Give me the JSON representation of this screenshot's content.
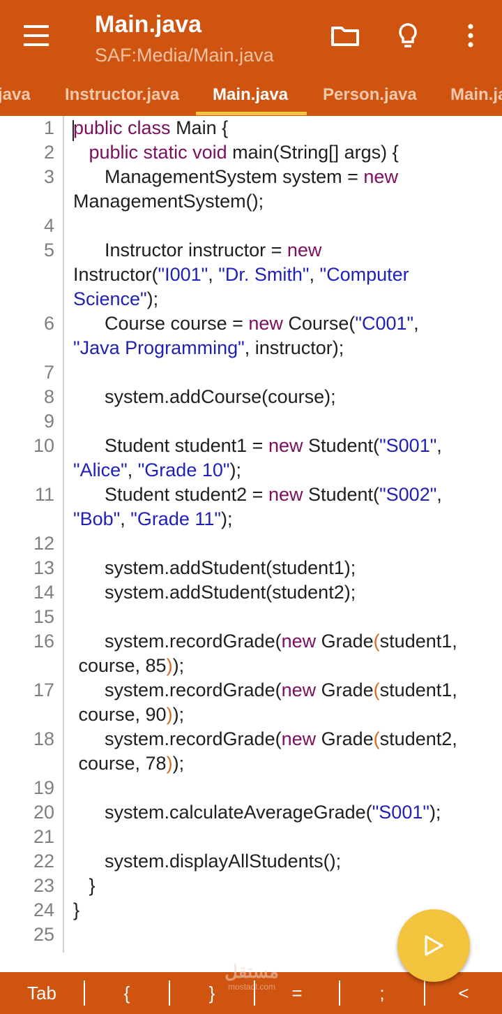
{
  "appbar": {
    "title": "Main.java",
    "subtitle": "SAF:Media/Main.java",
    "icons": [
      "menu-icon",
      "folder-icon",
      "lightbulb-icon",
      "more-vertical-icon"
    ]
  },
  "tabs": [
    {
      "label": "java"
    },
    {
      "label": "Instructor.java"
    },
    {
      "label": "Main.java",
      "active": true
    },
    {
      "label": "Person.java"
    },
    {
      "label": "Main.ja"
    }
  ],
  "editor": {
    "line_numbers": [
      "1",
      "2",
      "3",
      "4",
      "5",
      "6",
      "7",
      "8",
      "9",
      "10",
      "11",
      "12",
      "13",
      "14",
      "15",
      "16",
      "17",
      "18",
      "19",
      "20",
      "21",
      "22",
      "23",
      "24",
      "25"
    ],
    "code": {
      "l1_kw": "public class",
      "l1_t": " Main {",
      "l2_kw": "   public static void",
      "l2_t": " main(String[] args) {",
      "l3_t": "      ManagementSystem system = ",
      "l3_kw": "new",
      "l3b_t": "ManagementSystem();",
      "l5_t": "      Instructor instructor = ",
      "l5_kw": "new",
      "l5b_t1": "Instructor(",
      "l5b_s1": "\"I001\"",
      "l5b_t2": ", ",
      "l5b_s2": "\"Dr. Smith\"",
      "l5b_t3": ", ",
      "l5b_s3": "\"Computer",
      "l5c_s": "Science\"",
      "l5c_t": ");",
      "l6_t1": "      Course course = ",
      "l6_kw": "new",
      "l6_t2": " Course(",
      "l6_s1": "\"C001\"",
      "l6_t3": ",",
      "l6b_s": "\"Java Programming\"",
      "l6b_t": ", instructor);",
      "l8_t": "      system.addCourse(course);",
      "l10_t1": "      Student student1 = ",
      "l10_kw": "new",
      "l10_t2": " Student(",
      "l10_s": "\"S001\"",
      "l10_t3": ",",
      "l10b_s1": "\"Alice\"",
      "l10b_t1": ", ",
      "l10b_s2": "\"Grade 10\"",
      "l10b_t2": ");",
      "l11_t1": "      Student student2 = ",
      "l11_kw": "new",
      "l11_t2": " Student(",
      "l11_s": "\"S002\"",
      "l11_t3": ",",
      "l11b_s1": "\"Bob\"",
      "l11b_t1": ", ",
      "l11b_s2": "\"Grade 11\"",
      "l11b_t2": ");",
      "l13_t": "      system.addStudent(student1);",
      "l14_t": "      system.addStudent(student2);",
      "l16_t1": "      system.recordGrade(",
      "l16_kw": "new",
      "l16_t2": " Grade",
      "l16_p": "(",
      "l16_t3": "student1,",
      "l16b_t": " course, 85",
      "l16b_p": ")",
      "l16b_t2": ");",
      "l17_t1": "      system.recordGrade(",
      "l17_kw": "new",
      "l17_t2": " Grade",
      "l17_p": "(",
      "l17_t3": "student1,",
      "l17b_t": " course, 90",
      "l17b_p": ")",
      "l17b_t2": ");",
      "l18_t1": "      system.recordGrade(",
      "l18_kw": "new",
      "l18_t2": " Grade",
      "l18_p": "(",
      "l18_t3": "student2,",
      "l18b_t": " course, 78",
      "l18b_p": ")",
      "l18b_t2": ");",
      "l20_t1": "      system.calculateAverageGrade(",
      "l20_s": "\"S001\"",
      "l20_t2": ");",
      "l22_t": "      system.displayAllStudents();",
      "l23_t": "   }",
      "l24_t": "}"
    }
  },
  "fab": {
    "icon": "play-icon"
  },
  "bottombar": {
    "keys": [
      "Tab",
      "{",
      "}",
      "=",
      ";",
      "<"
    ]
  },
  "watermark": {
    "arabic": "مستقل",
    "latin": "mostaql.com"
  },
  "colors": {
    "primary": "#cf5410",
    "accent": "#f3c33e",
    "keyword": "#7c0e5f",
    "string": "#1f1fba"
  }
}
